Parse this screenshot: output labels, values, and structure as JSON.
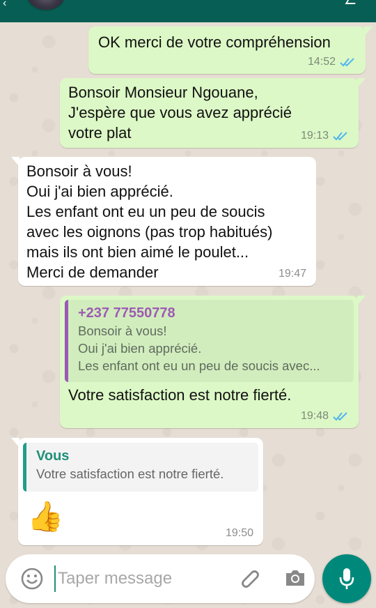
{
  "messages": [
    {
      "direction": "out",
      "text": "OK merci de votre compréhension",
      "time": "14:52",
      "status": "read",
      "status_icon": "double-check-icon"
    },
    {
      "direction": "out",
      "text": "Bonsoir Monsieur Ngouane,\nJ'espère que vous avez apprécié\nvotre plat",
      "time": "19:13",
      "status": "read",
      "status_icon": "double-check-icon"
    },
    {
      "direction": "in",
      "text": "Bonsoir à vous!\nOui j'ai bien apprécié.\nLes enfant ont eu un peu de soucis\navec les oignons (pas trop habitués)\nmais ils ont bien aimé le poulet...\nMerci de demander",
      "time": "19:47"
    },
    {
      "direction": "out",
      "quote": {
        "author": "+237 77550778",
        "text": "Bonsoir à vous!\nOui j'ai bien apprécié.\nLes enfant ont eu un peu de soucis avec..."
      },
      "text": "Votre satisfaction est notre fierté.",
      "time": "19:48",
      "status": "read",
      "status_icon": "double-check-icon"
    },
    {
      "direction": "in",
      "quote": {
        "author": "Vous",
        "text": "Votre satisfaction est notre fierté."
      },
      "text": "👍",
      "time": "19:50"
    }
  ],
  "composer": {
    "placeholder": "Taper message",
    "icons": [
      "emoji-icon",
      "attach-icon",
      "camera-icon",
      "mic-icon"
    ]
  },
  "colors": {
    "header": "#075e54",
    "outgoing_bubble": "#dcf8c6",
    "incoming_bubble": "#ffffff",
    "read_ticks": "#4fb6ec",
    "mic_button": "#00897b",
    "quote_author_contact": "#9d5ab4",
    "quote_author_self": "#1f8f78"
  }
}
